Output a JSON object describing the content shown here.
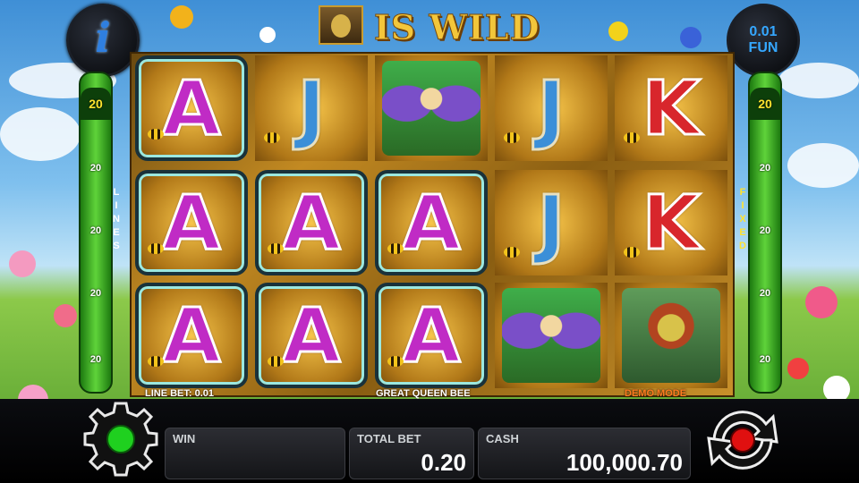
{
  "header": {
    "info_icon": "info-icon",
    "info_glyph": "i",
    "title_text": "IS WILD",
    "denomination": "0.01",
    "mode": "FUN"
  },
  "left_bar": {
    "word": "LINES",
    "values": [
      "20",
      "20",
      "20",
      "20",
      "20",
      "20"
    ]
  },
  "right_bar": {
    "word": "FIXED",
    "values": [
      "20",
      "20",
      "20",
      "20",
      "20",
      "20"
    ]
  },
  "reels": {
    "grid": [
      [
        "A",
        "A",
        "A"
      ],
      [
        "J",
        "A",
        "A"
      ],
      [
        "FAIRY",
        "A",
        "A"
      ],
      [
        "J",
        "J",
        "FAIRY"
      ],
      [
        "K",
        "K",
        "QUEEN"
      ]
    ],
    "winning": [
      [
        true,
        true,
        true
      ],
      [
        false,
        true,
        true
      ],
      [
        false,
        true,
        true
      ],
      [
        false,
        false,
        false
      ],
      [
        false,
        false,
        false
      ]
    ],
    "line_bet_label": "LINE BET: 0.01",
    "feature_label": "GREAT QUEEN BEE",
    "demo_label": "DEMO MODE"
  },
  "bottom": {
    "settings_icon": "gear-icon",
    "spin_icon": "spin-icon",
    "win_label": "WIN",
    "win_value": "",
    "total_bet_label": "TOTAL BET",
    "total_bet_value": "0.20",
    "cash_label": "CASH",
    "cash_value": "100,000.70",
    "colors": {
      "gear_light": "#1fd01f",
      "spin_core": "#e01010"
    }
  }
}
